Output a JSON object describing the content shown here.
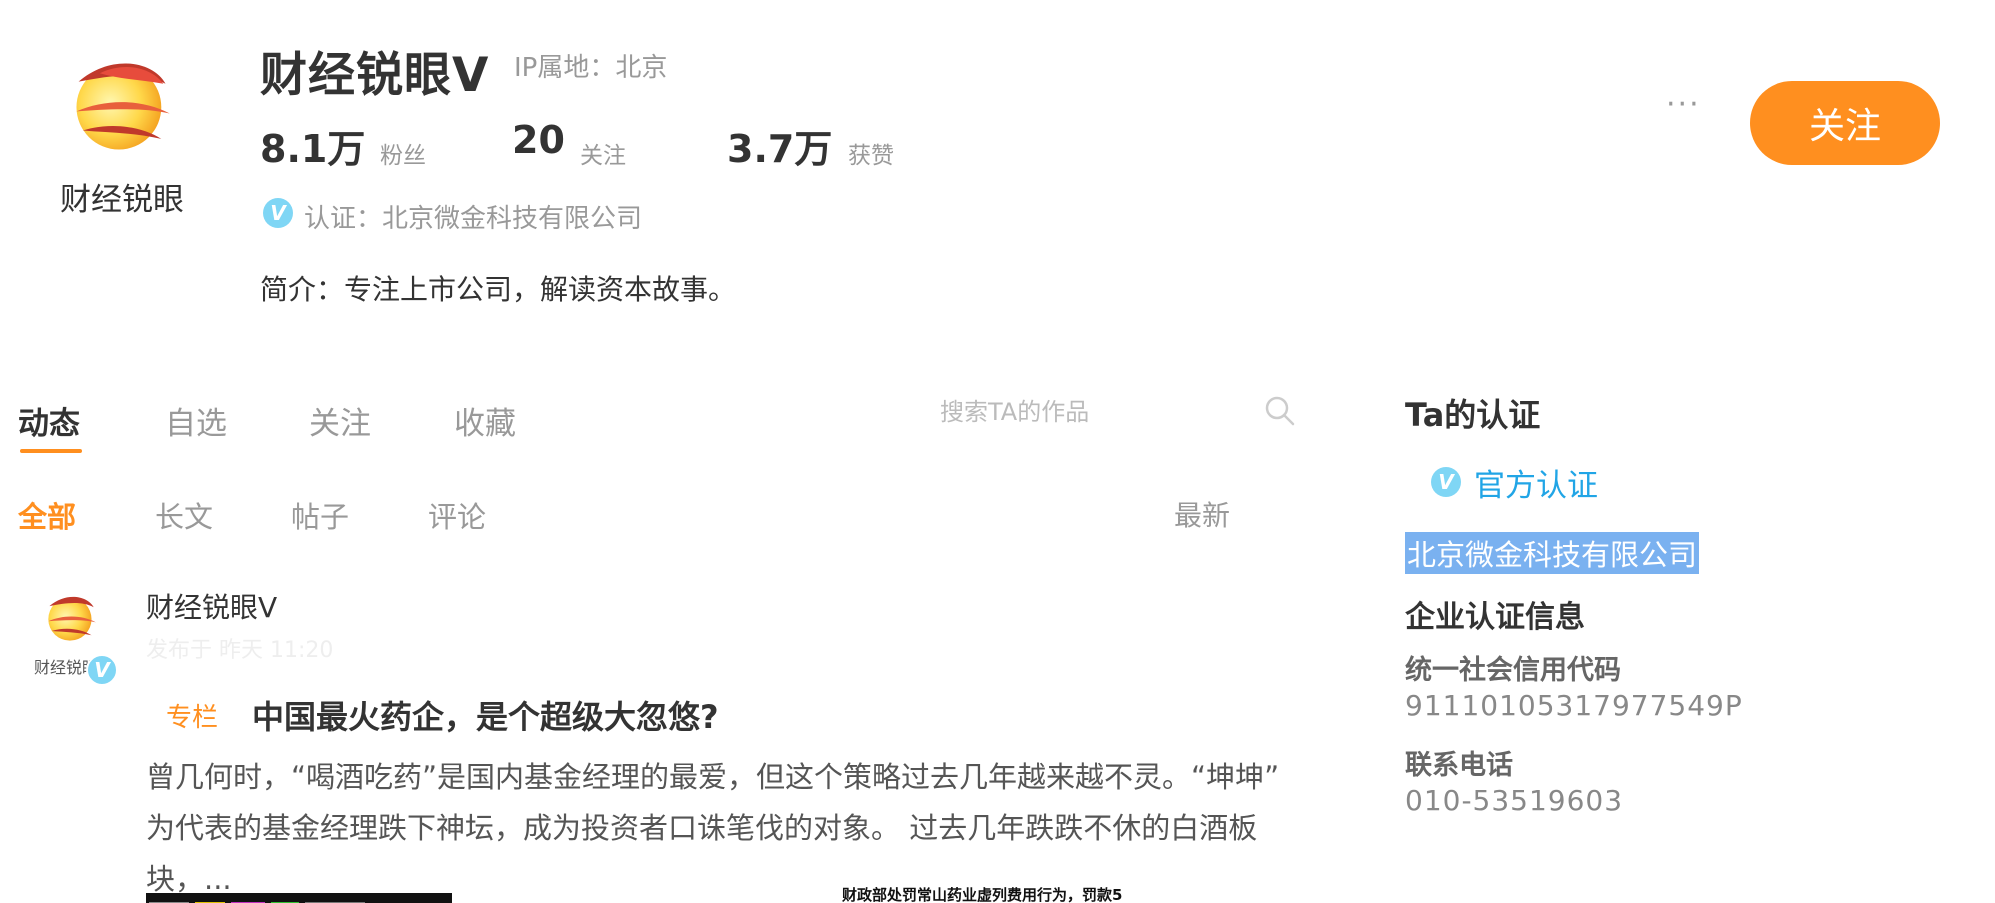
{
  "profile": {
    "avatar_caption": "财经锐眼",
    "name": "财经锐眼V",
    "ip_location": "IP属地：北京",
    "stats": [
      {
        "value": "8.1万",
        "label": "粉丝"
      },
      {
        "value": "20",
        "label": "关注"
      },
      {
        "value": "3.7万",
        "label": "获赞"
      }
    ],
    "verification": "认证：北京微金科技有限公司",
    "bio": "简介：专注上市公司，解读资本故事。",
    "more_label": "···",
    "follow_label": "关注"
  },
  "tabs": [
    {
      "label": "动态",
      "active": true
    },
    {
      "label": "自选",
      "active": false
    },
    {
      "label": "关注",
      "active": false
    },
    {
      "label": "收藏",
      "active": false
    }
  ],
  "search": {
    "placeholder": "搜索TA的作品"
  },
  "subtabs": [
    {
      "label": "全部",
      "active": true
    },
    {
      "label": "长文",
      "active": false
    },
    {
      "label": "帖子",
      "active": false
    },
    {
      "label": "评论",
      "active": false
    }
  ],
  "sort_label": "最新",
  "post": {
    "avatar_caption": "财经锐眼",
    "author": "财经锐眼V",
    "time": "发布于 昨天 11:20",
    "tag": "专栏",
    "title": "中国最火药企，是个超级大忽悠?",
    "summary_line1": "曾几何时，“喝酒吃药”是国内基金经理的最爱，但这个策略过去几年越来越不灵。“坤坤”",
    "summary_line2": "为代表的基金经理跌下神坛，成为投资者口诛笔伐的对象。 过去几年跌跌不休的白酒板块，...",
    "image_caption": "财政部处罚常山药业虚列费用行为，罚款5"
  },
  "sidebar": {
    "title": "Ta的认证",
    "official": "官方认证",
    "company": "北京微金科技有限公司",
    "section_title": "企业认证信息",
    "credit_code_label": "统一社会信用代码",
    "credit_code": "91110105317977549P",
    "phone_label": "联系电话",
    "phone": "010-53519603"
  },
  "colors": {
    "accent": "#ff8f1f",
    "verified_blue": "#21a5e6",
    "highlight": "#7ab1f0"
  }
}
